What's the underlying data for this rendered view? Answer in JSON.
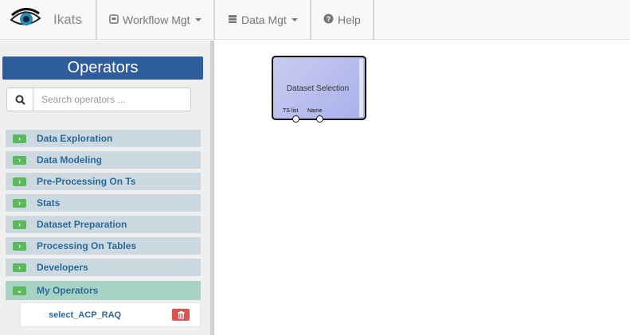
{
  "navbar": {
    "brand": "Ikats",
    "workflow": "Workflow Mgt",
    "data": "Data Mgt",
    "help": "Help"
  },
  "sidebar": {
    "title": "Operators",
    "search_placeholder": "Search operators ...",
    "categories": [
      {
        "label": "Data Exploration",
        "expanded": false
      },
      {
        "label": "Data Modeling",
        "expanded": false
      },
      {
        "label": "Pre-Processing On Ts",
        "expanded": false
      },
      {
        "label": "Stats",
        "expanded": false
      },
      {
        "label": "Dataset Preparation",
        "expanded": false
      },
      {
        "label": "Processing On Tables",
        "expanded": false
      },
      {
        "label": "Developers",
        "expanded": false
      },
      {
        "label": "My Operators",
        "expanded": true
      }
    ],
    "my_operators": [
      "select_ACP_RAQ"
    ]
  },
  "canvas": {
    "node": {
      "title": "Dataset Selection",
      "ports": [
        "TS list",
        "Name"
      ]
    }
  },
  "colors": {
    "accent": "#2f5d9b",
    "toggle": "#5cb85c",
    "category": "#cdd9e0",
    "category_open": "#a7d3c5",
    "delete": "#d9534f"
  }
}
